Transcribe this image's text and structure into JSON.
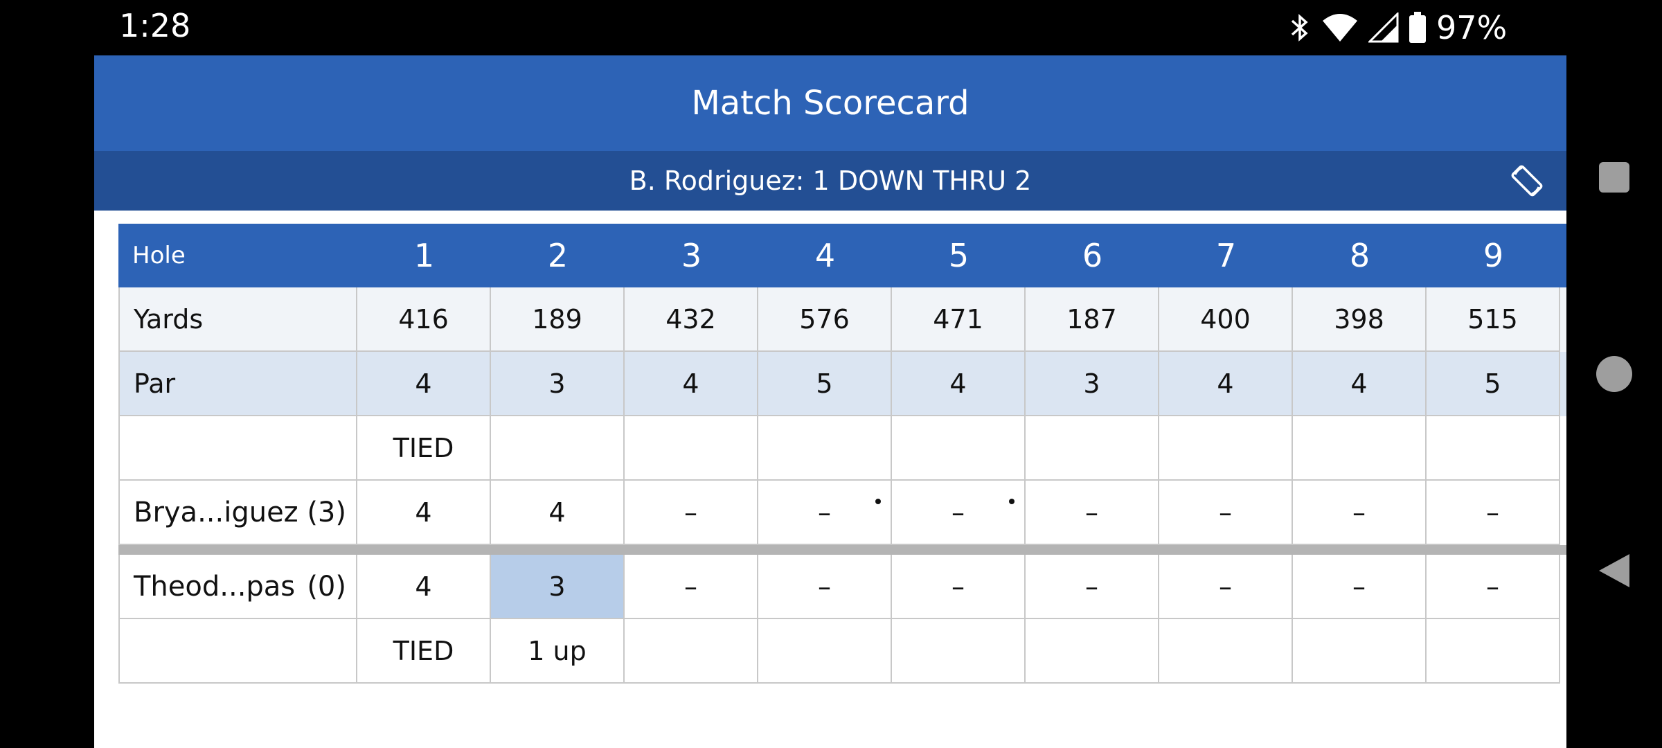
{
  "status_bar": {
    "time": "1:28",
    "battery_percent": "97%",
    "icons": [
      "bluetooth-icon",
      "wifi-icon",
      "cell-signal-icon",
      "battery-icon"
    ]
  },
  "header": {
    "title": "Match Scorecard",
    "match_status": "B. Rodriguez: 1 DOWN THRU 2"
  },
  "scorecard": {
    "hole_label": "Hole",
    "holes": [
      "1",
      "2",
      "3",
      "4",
      "5",
      "6",
      "7",
      "8",
      "9"
    ],
    "yards_label": "Yards",
    "yards": [
      "416",
      "189",
      "432",
      "576",
      "471",
      "187",
      "400",
      "398",
      "515"
    ],
    "par_label": "Par",
    "par": [
      "4",
      "3",
      "4",
      "5",
      "4",
      "3",
      "4",
      "4",
      "5"
    ],
    "top_status": [
      "TIED",
      "",
      "",
      "",
      "",
      "",
      "",
      "",
      ""
    ],
    "player1": {
      "name": "Brya...iguez",
      "handicap": "(3)",
      "scores": [
        "4",
        "4",
        "–",
        "–",
        "–",
        "–",
        "–",
        "–",
        "–"
      ],
      "stroke_dots": [
        false,
        false,
        false,
        true,
        true,
        false,
        false,
        false,
        false
      ]
    },
    "player2": {
      "name": "Theod...pas",
      "handicap": "(0)",
      "scores": [
        "4",
        "3",
        "–",
        "–",
        "–",
        "–",
        "–",
        "–",
        "–"
      ],
      "winning_holes": [
        false,
        true,
        false,
        false,
        false,
        false,
        false,
        false,
        false
      ]
    },
    "bottom_status": [
      "TIED",
      "1 up",
      "",
      "",
      "",
      "",
      "",
      "",
      ""
    ]
  },
  "colors": {
    "header_blue": "#2d63b6",
    "status_blue": "#234f94",
    "hole_win_highlight": "#b7cde9"
  }
}
